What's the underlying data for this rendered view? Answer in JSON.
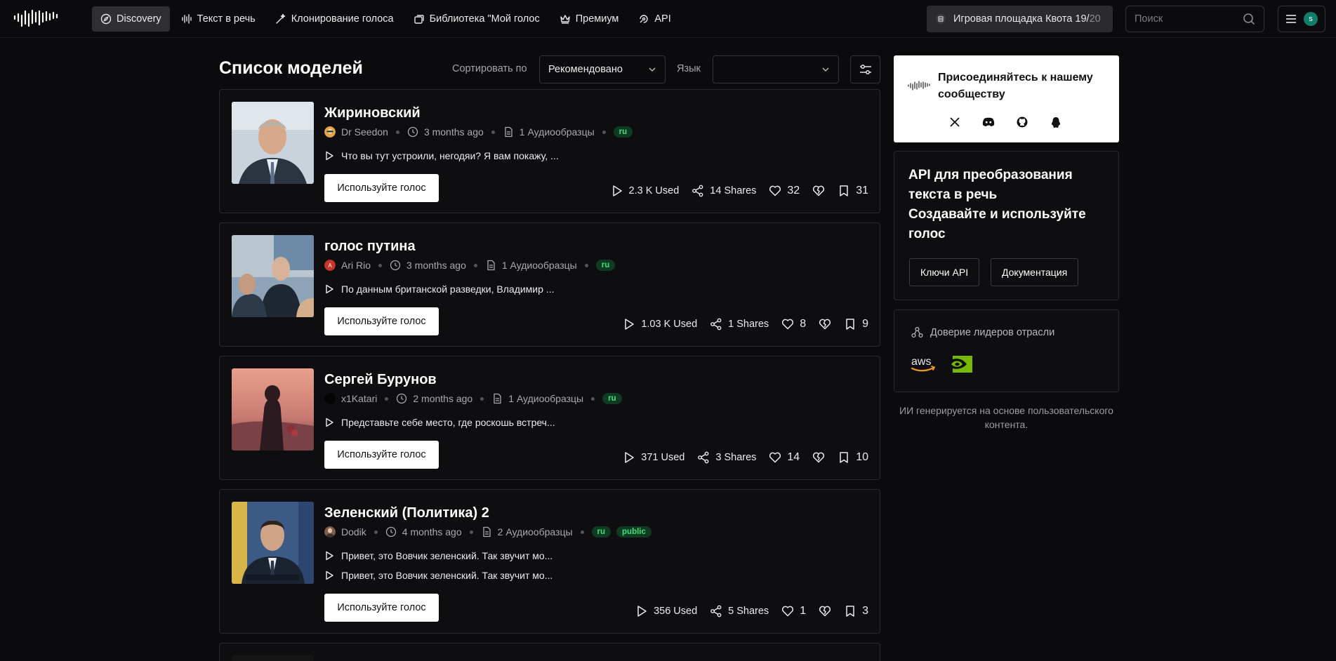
{
  "nav": {
    "items": [
      {
        "label": "Discovery",
        "icon": "compass-icon",
        "active": true
      },
      {
        "label": "Текст в речь",
        "icon": "waveform-icon"
      },
      {
        "label": "Клонирование голоса",
        "icon": "magic-wand-icon"
      },
      {
        "label": "Библиотека \"Мой голос",
        "icon": "library-icon"
      },
      {
        "label": "Премиум",
        "icon": "crown-icon"
      },
      {
        "label": "API",
        "icon": "api-icon"
      }
    ],
    "quota": {
      "label": "Игровая площадка Квота",
      "used": "19/",
      "total": "20"
    },
    "search_placeholder": "Поиск",
    "user_initial": "s"
  },
  "list": {
    "title": "Список моделей",
    "sort_label": "Сортировать по",
    "sort_value": "Рекомендовано",
    "lang_label": "Язык",
    "lang_value": ""
  },
  "models": [
    {
      "title": "Жириновский",
      "author": "Dr Seedon",
      "time": "3 months ago",
      "samples_count": "1 Аудиообразцы",
      "tags": [
        "ru"
      ],
      "samples": [
        "Что вы тут устроили, негодяи? Я вам покажу, ..."
      ],
      "use_label": "Используйте голос",
      "used": "2.3 K Used",
      "shares": "14 Shares",
      "likes": "32",
      "saves": "31"
    },
    {
      "title": "голос путина",
      "author": "Ari Rio",
      "time": "3 months ago",
      "samples_count": "1 Аудиообразцы",
      "tags": [
        "ru"
      ],
      "samples": [
        "По данным британской разведки, Владимир ..."
      ],
      "use_label": "Используйте голос",
      "used": "1.03 K Used",
      "shares": "1 Shares",
      "likes": "8",
      "saves": "9"
    },
    {
      "title": "Сергей Бурунов",
      "author": "x1Katari",
      "time": "2 months ago",
      "samples_count": "1 Аудиообразцы",
      "tags": [
        "ru"
      ],
      "samples": [
        "Представьте себе место, где роскошь встреч..."
      ],
      "use_label": "Используйте голос",
      "used": "371 Used",
      "shares": "3 Shares",
      "likes": "14",
      "saves": "10"
    },
    {
      "title": "Зеленский (Политика) 2",
      "author": "Dodik",
      "time": "4 months ago",
      "samples_count": "2 Аудиообразцы",
      "tags": [
        "ru",
        "public"
      ],
      "samples": [
        "Привет, это Вовчик зеленский. Так звучит мо...",
        "Привет, это Вовчик зеленский. Так звучит мо..."
      ],
      "use_label": "Используйте голос",
      "used": "356 Used",
      "shares": "5 Shares",
      "likes": "1",
      "saves": "3"
    }
  ],
  "sidebar": {
    "community_text": "Присоединяйтесь к нашему сообществу",
    "socials": [
      "x-icon",
      "discord-icon",
      "github-icon",
      "qq-icon"
    ],
    "api_title_1": "API для преобразования текста в речь",
    "api_title_2": "Создавайте и используйте голос",
    "api_keys_label": "Ключи API",
    "docs_label": "Документация",
    "trust_label": "Доверие лидеров отрасли",
    "partners": [
      "aws",
      "nvidia-logo"
    ],
    "footnote": "ИИ генерируется на основе пользовательского контента."
  },
  "colors": {
    "background": "#0b0b0d",
    "card": "#0e0e11",
    "tag_green": "#3fe07a",
    "avatar": "#0f7d6a"
  }
}
